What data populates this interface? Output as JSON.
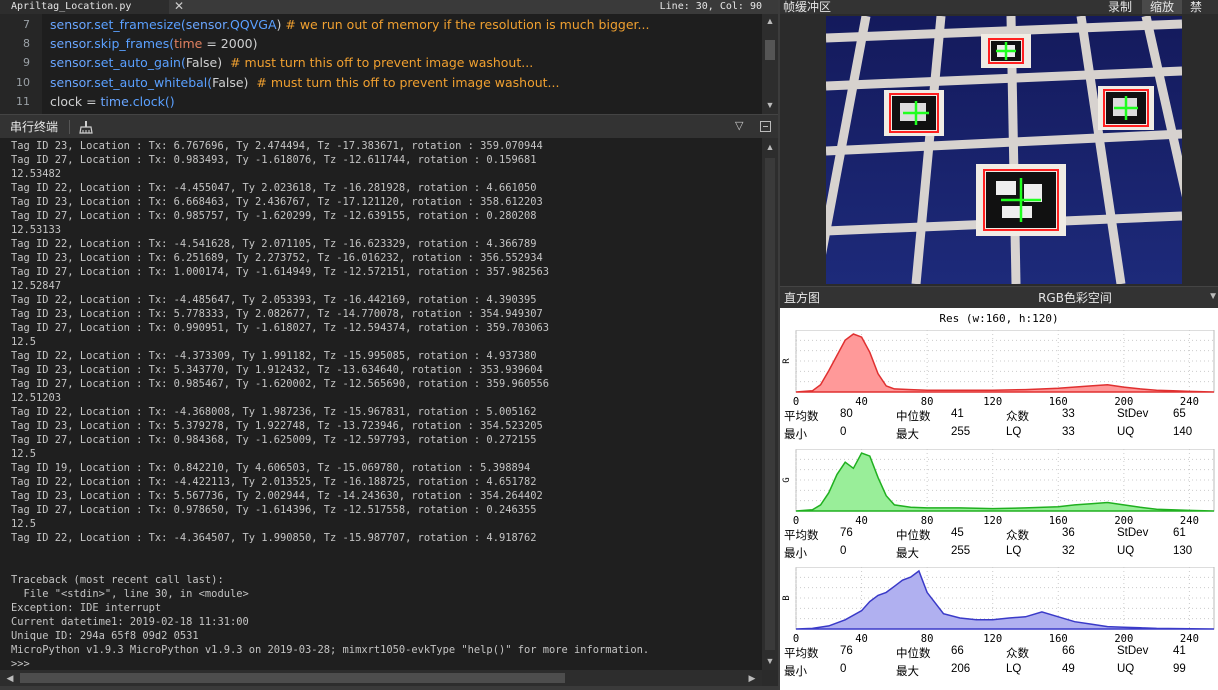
{
  "editor": {
    "tab_title": "Apriltag_Location.py",
    "close_glyph": "✕",
    "cursor": "Line: 30, Col: 90",
    "lines": [
      {
        "n": "7",
        "parts": [
          [
            "sensor",
            "c-obj"
          ],
          [
            ".set_framesize(",
            "c-fn"
          ],
          [
            "sensor",
            "c-obj"
          ],
          [
            ".QQVGA",
            "c-fn"
          ],
          [
            ") ",
            "c-kw"
          ],
          [
            "# we run out of memory if the resolution is much bigger...",
            "c-cm"
          ]
        ]
      },
      {
        "n": "8",
        "parts": [
          [
            "sensor",
            "c-obj"
          ],
          [
            ".skip_frames(",
            "c-fn"
          ],
          [
            "time",
            "c-arg"
          ],
          [
            " = 2000)",
            "c-num"
          ]
        ]
      },
      {
        "n": "9",
        "parts": [
          [
            "sensor",
            "c-obj"
          ],
          [
            ".set_auto_gain(",
            "c-fn"
          ],
          [
            "False",
            "c-kw"
          ],
          [
            ")  ",
            "c-kw"
          ],
          [
            "# must turn this off to prevent image washout...",
            "c-cm"
          ]
        ]
      },
      {
        "n": "10",
        "parts": [
          [
            "sensor",
            "c-obj"
          ],
          [
            ".set_auto_whitebal(",
            "c-fn"
          ],
          [
            "False",
            "c-kw"
          ],
          [
            ")  ",
            "c-kw"
          ],
          [
            "# must turn this off to prevent image washout...",
            "c-cm"
          ]
        ]
      },
      {
        "n": "11",
        "parts": [
          [
            "clock",
            "c-kw"
          ],
          [
            " = ",
            "c-kw"
          ],
          [
            "time",
            "c-obj"
          ],
          [
            ".clock()",
            "c-fn"
          ]
        ]
      }
    ]
  },
  "serial": {
    "title": "串行终端",
    "lines": [
      "Tag ID 23, Location : Tx: 6.767696, Ty 2.474494, Tz -17.383671, rotation : 359.070944",
      "Tag ID 27, Location : Tx: 0.983493, Ty -1.618076, Tz -12.611744, rotation : 0.159681",
      "12.53482",
      "Tag ID 22, Location : Tx: -4.455047, Ty 2.023618, Tz -16.281928, rotation : 4.661050",
      "Tag ID 23, Location : Tx: 6.668463, Ty 2.436767, Tz -17.121120, rotation : 358.612203",
      "Tag ID 27, Location : Tx: 0.985757, Ty -1.620299, Tz -12.639155, rotation : 0.280208",
      "12.53133",
      "Tag ID 22, Location : Tx: -4.541628, Ty 2.071105, Tz -16.623329, rotation : 4.366789",
      "Tag ID 23, Location : Tx: 6.251689, Ty 2.273752, Tz -16.016232, rotation : 356.552934",
      "Tag ID 27, Location : Tx: 1.000174, Ty -1.614949, Tz -12.572151, rotation : 357.982563",
      "12.52847",
      "Tag ID 22, Location : Tx: -4.485647, Ty 2.053393, Tz -16.442169, rotation : 4.390395",
      "Tag ID 23, Location : Tx: 5.778333, Ty 2.082677, Tz -14.770078, rotation : 354.949307",
      "Tag ID 27, Location : Tx: 0.990951, Ty -1.618027, Tz -12.594374, rotation : 359.703063",
      "12.5",
      "Tag ID 22, Location : Tx: -4.373309, Ty 1.991182, Tz -15.995085, rotation : 4.937380",
      "Tag ID 23, Location : Tx: 5.343770, Ty 1.912432, Tz -13.634640, rotation : 353.939604",
      "Tag ID 27, Location : Tx: 0.985467, Ty -1.620002, Tz -12.565690, rotation : 359.960556",
      "12.51203",
      "Tag ID 22, Location : Tx: -4.368008, Ty 1.987236, Tz -15.967831, rotation : 5.005162",
      "Tag ID 23, Location : Tx: 5.379278, Ty 1.922748, Tz -13.723946, rotation : 354.523205",
      "Tag ID 27, Location : Tx: 0.984368, Ty -1.625009, Tz -12.597793, rotation : 0.272155",
      "12.5",
      "Tag ID 19, Location : Tx: 0.842210, Ty 4.606503, Tz -15.069780, rotation : 5.398894",
      "Tag ID 22, Location : Tx: -4.422113, Ty 2.013525, Tz -16.188725, rotation : 4.651782",
      "Tag ID 23, Location : Tx: 5.567736, Ty 2.002944, Tz -14.243630, rotation : 354.264402",
      "Tag ID 27, Location : Tx: 0.978650, Ty -1.614396, Tz -12.517558, rotation : 0.246355",
      "12.5",
      "Tag ID 22, Location : Tx: -4.364507, Ty 1.990850, Tz -15.987707, rotation : 4.918762",
      "",
      "",
      "Traceback (most recent call last):",
      "  File \"<stdin>\", line 30, in <module>",
      "Exception: IDE interrupt",
      "Current datetime1: 2019-02-18 11:31:00",
      "Unique ID: 294a 65f8 09d2 0531",
      "MicroPython v1.9.3 MicroPython v1.9.3 on 2019-03-28; mimxrt1050-evkType \"help()\" for more information.",
      ">>>"
    ]
  },
  "framebuffer": {
    "title": "帧缓冲区",
    "buttons": [
      "录制",
      "缩放",
      "禁用"
    ],
    "active_button": "缩放"
  },
  "histogram": {
    "title": "直方图",
    "colorspace": "RGB色彩空间",
    "resolution": "Res (w:160, h:120)",
    "x_ticks": [
      "0",
      "40",
      "80",
      "120",
      "160",
      "200",
      "240"
    ],
    "stat_labels": [
      "平均数",
      "中位数",
      "众数",
      "StDev",
      "最小",
      "最大",
      "LQ",
      "UQ"
    ],
    "channels": [
      {
        "name": "R",
        "color": "#ff9999",
        "stroke": "#e03030",
        "stats": {
          "mean": "80",
          "median": "41",
          "mode": "33",
          "stdev": "65",
          "min": "0",
          "max": "255",
          "lq": "33",
          "uq": "140"
        }
      },
      {
        "name": "G",
        "color": "#99ee99",
        "stroke": "#20b020",
        "stats": {
          "mean": "76",
          "median": "45",
          "mode": "36",
          "stdev": "61",
          "min": "0",
          "max": "255",
          "lq": "32",
          "uq": "130"
        }
      },
      {
        "name": "B",
        "color": "#b0b0f0",
        "stroke": "#3a3ac8",
        "stats": {
          "mean": "76",
          "median": "66",
          "mode": "66",
          "stdev": "41",
          "min": "0",
          "max": "206",
          "lq": "49",
          "uq": "99"
        }
      }
    ]
  },
  "chart_data": [
    {
      "type": "area",
      "title": "",
      "series": [
        {
          "name": "R",
          "x": [
            0,
            10,
            15,
            20,
            25,
            30,
            35,
            40,
            45,
            50,
            55,
            60,
            70,
            80,
            100,
            120,
            140,
            160,
            180,
            190,
            200,
            210,
            220,
            230,
            240,
            255
          ],
          "values": [
            0,
            2,
            12,
            35,
            60,
            85,
            95,
            90,
            65,
            30,
            10,
            5,
            4,
            3,
            3,
            3,
            4,
            6,
            10,
            12,
            8,
            5,
            3,
            2,
            1,
            0
          ]
        }
      ]
    },
    {
      "type": "area",
      "title": "",
      "series": [
        {
          "name": "G",
          "x": [
            0,
            10,
            15,
            20,
            25,
            30,
            35,
            40,
            45,
            50,
            55,
            60,
            70,
            80,
            100,
            120,
            140,
            160,
            170,
            180,
            190,
            200,
            210,
            220,
            240,
            255
          ],
          "values": [
            0,
            2,
            10,
            30,
            60,
            80,
            70,
            95,
            90,
            55,
            25,
            10,
            6,
            5,
            5,
            4,
            5,
            7,
            10,
            12,
            14,
            10,
            6,
            3,
            1,
            0
          ]
        }
      ]
    },
    {
      "type": "area",
      "title": "",
      "series": [
        {
          "name": "B",
          "x": [
            0,
            10,
            20,
            30,
            40,
            45,
            50,
            55,
            60,
            65,
            70,
            75,
            80,
            90,
            100,
            110,
            120,
            130,
            140,
            150,
            160,
            170,
            180,
            190,
            200,
            210,
            220,
            255
          ],
          "values": [
            0,
            1,
            5,
            15,
            30,
            45,
            55,
            60,
            70,
            80,
            85,
            95,
            60,
            25,
            18,
            15,
            15,
            18,
            20,
            28,
            20,
            12,
            8,
            4,
            3,
            2,
            1,
            0
          ]
        }
      ]
    }
  ]
}
